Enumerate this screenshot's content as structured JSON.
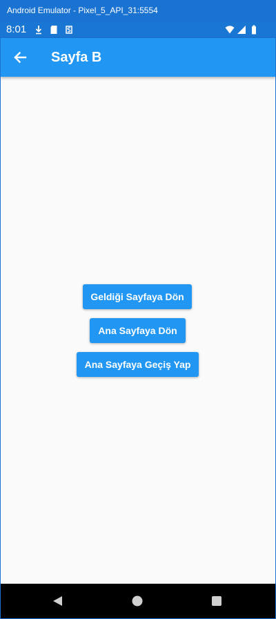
{
  "window": {
    "title": "Android Emulator - Pixel_5_API_31:5554"
  },
  "status_bar": {
    "time": "8:01",
    "left_icons": [
      "download-icon",
      "sd-card-icon",
      "shield-s-icon"
    ],
    "right_icons": [
      "wifi-icon",
      "cellular-signal-icon",
      "battery-icon"
    ]
  },
  "app_bar": {
    "title": "Sayfa B",
    "back_icon": "arrow-back-icon"
  },
  "buttons": {
    "back_to_previous": "Geldiği Sayfaya Dön",
    "back_to_home": "Ana Sayfaya Dön",
    "go_to_home": "Ana Sayfaya Geçiş Yap"
  },
  "nav_bar": {
    "icons": [
      "back-triangle-icon",
      "home-circle-icon",
      "recents-square-icon"
    ]
  },
  "colors": {
    "primary": "#2196f3",
    "status_bar": "#1976d2",
    "window_frame": "#1a73d1",
    "background": "#fafafa",
    "nav_bar": "#000000"
  }
}
